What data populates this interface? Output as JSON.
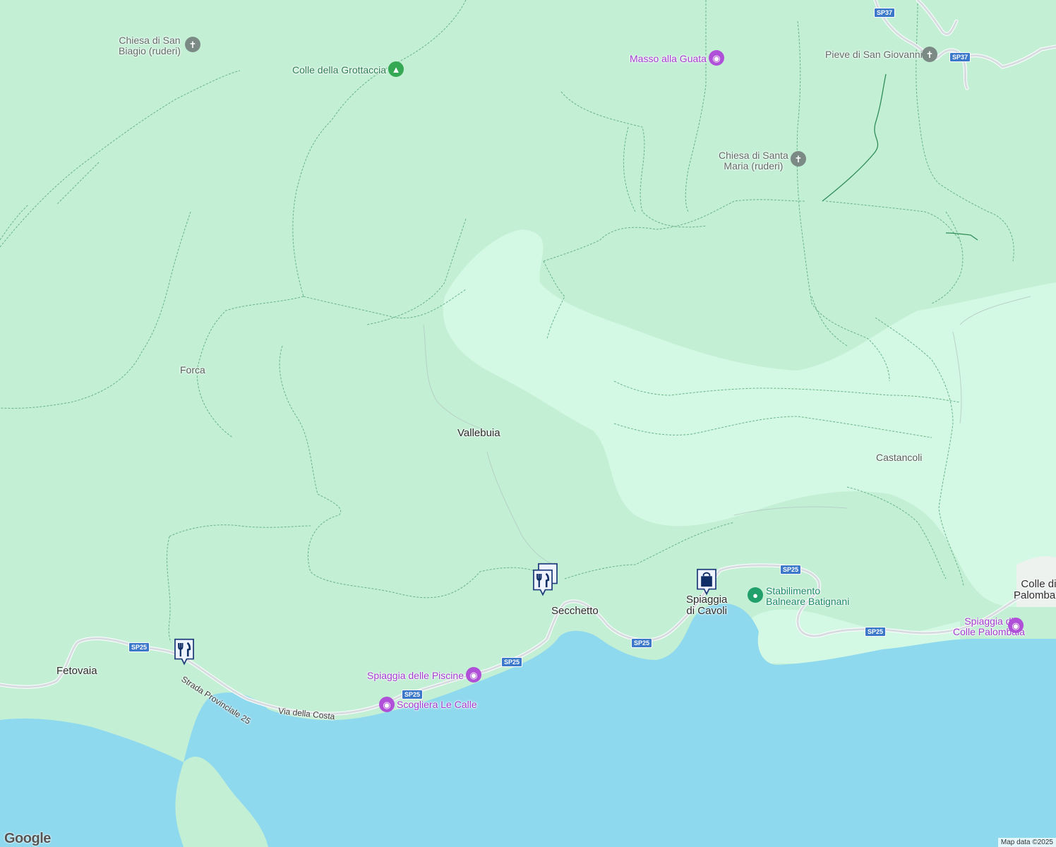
{
  "map": {
    "colors": {
      "land": "#c3efd5",
      "light_land": "#d3f8e3",
      "water": "#8fd9ee",
      "road": "#d6dce0",
      "trail": "#5fae80"
    },
    "places": {
      "chiesa_san_biagio": "Chiesa di San\nBiagio (ruderi)",
      "colle_grottaccia": "Colle della Grottaccia",
      "masso_guata": "Masso alla Guata",
      "pieve_san_giovanni": "Pieve di San Giovanni",
      "chiesa_santa_maria": "Chiesa di Santa\nMaria (ruderi)",
      "forca": "Forca",
      "vallebuia": "Vallebuia",
      "castancoli": "Castancoli",
      "seccheto": "Secchetto",
      "spiaggia_cavoli": "Spiaggia\ndi Cavoli",
      "stabilimento": "Stabilimento\nBalneare Batignani",
      "colle_palombaia": "Colle di\nPalombaia",
      "spiaggia_colle_palombaia": "Spiaggia di\nColle Palombaia",
      "fetovaia": "Fetovaia",
      "spiaggia_piscine": "Spiaggia delle Piscine",
      "scogliera_calle": "Scogliera Le Calle"
    },
    "roads": {
      "provinciale": "Strada Provinciale 25",
      "via_costa": "Via della Costa",
      "sp25": "SP25",
      "sp37": "SP37"
    },
    "icons": {
      "church": "church-icon",
      "camera": "camera-icon",
      "tree": "tree-icon",
      "restaurant": "restaurant-icon",
      "shopping": "shopping-bag-icon",
      "beach": "beach-icon"
    }
  },
  "footer": {
    "brand": "Google",
    "attribution": "Map data ©2025"
  }
}
